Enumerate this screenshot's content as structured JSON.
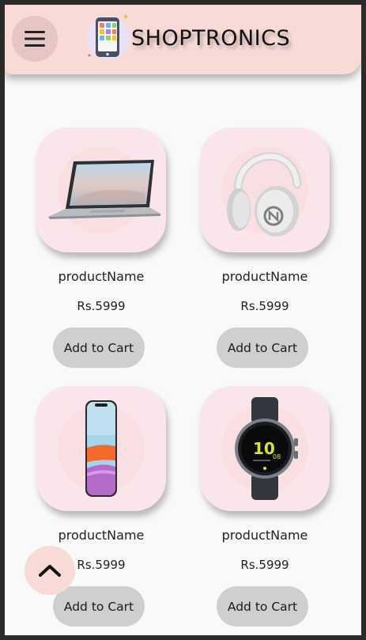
{
  "header": {
    "brand": "SHOPTRONICS",
    "menu_icon": "hamburger-menu-icon",
    "logo_icon": "smartphone-apps-icon"
  },
  "products": [
    {
      "name": "productName",
      "price": "Rs.5999",
      "button": "Add to Cart",
      "image": "laptop"
    },
    {
      "name": "productName",
      "price": "Rs.5999",
      "button": "Add to Cart",
      "image": "headphones"
    },
    {
      "name": "productName",
      "price": "Rs.5999",
      "button": "Add to Cart",
      "image": "smartphone"
    },
    {
      "name": "productName",
      "price": "Rs.5999",
      "button": "Add to Cart",
      "image": "smartwatch"
    }
  ],
  "watch_face": {
    "hour": "10",
    "minute": "08"
  },
  "scroll_top_icon": "chevron-up-icon",
  "colors": {
    "header_bg": "#f8dad6",
    "card_bg": "#fae6ea",
    "button_bg": "#cfcfcf",
    "watch_accent": "#d8e23a"
  }
}
